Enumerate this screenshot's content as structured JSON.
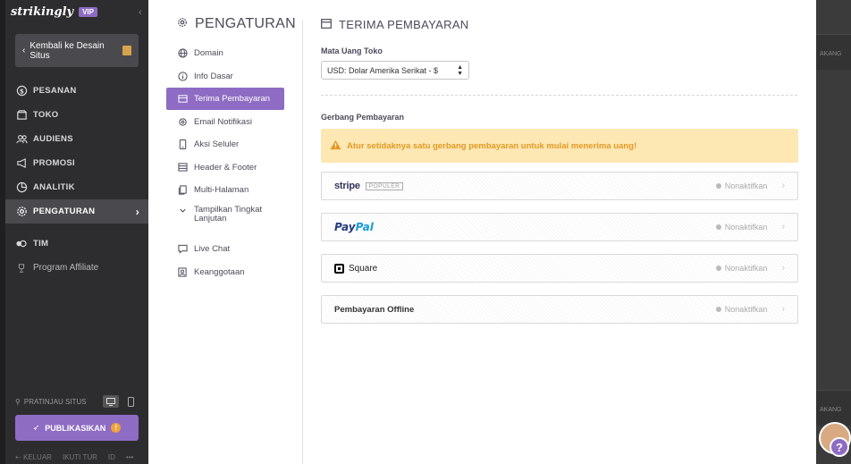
{
  "sidebar": {
    "brand": "strikingly",
    "badge": "VIP",
    "back_button": "Kembali ke Desain Situs",
    "items": [
      {
        "label": "PESANAN",
        "icon": "dollar-circle-icon"
      },
      {
        "label": "TOKO",
        "icon": "store-icon"
      },
      {
        "label": "AUDIENS",
        "icon": "users-icon"
      },
      {
        "label": "PROMOSI",
        "icon": "megaphone-icon"
      },
      {
        "label": "ANALITIK",
        "icon": "pie-chart-icon"
      },
      {
        "label": "PENGATURAN",
        "icon": "gear-icon"
      },
      {
        "label": "TIM",
        "icon": "team-icon"
      },
      {
        "label": "Program Affiliate",
        "icon": "trophy-icon"
      }
    ],
    "preview_label": "PRATINJAU SITUS",
    "publish_label": "PUBLIKASIKAN",
    "footer": [
      "KELUAR",
      "IKUTI TUR",
      "ID",
      "•••"
    ]
  },
  "settings_nav": {
    "title": "PENGATURAN",
    "items": [
      {
        "label": "Domain",
        "icon": "globe-icon"
      },
      {
        "label": "Info Dasar",
        "icon": "info-icon"
      },
      {
        "label": "Terima Pembayaran",
        "icon": "payment-icon"
      },
      {
        "label": "Email Notifikasi",
        "icon": "email-icon"
      },
      {
        "label": "Aksi Seluler",
        "icon": "mobile-icon"
      },
      {
        "label": "Header & Footer",
        "icon": "header-footer-icon"
      },
      {
        "label": "Multi-Halaman",
        "icon": "pages-icon"
      },
      {
        "label": "Tampilkan Tingkat Lanjutan",
        "icon": "chevron-down-icon"
      },
      {
        "label": "Live Chat",
        "icon": "chat-icon"
      },
      {
        "label": "Keanggotaan",
        "icon": "membership-icon"
      }
    ]
  },
  "payment": {
    "title": "TERIMA PEMBAYARAN",
    "currency_label": "Mata Uang Toko",
    "currency_value": "USD: Dolar Amerika Serikat - $",
    "gateway_label": "Gerbang Pembayaran",
    "alert": "Atur setidaknya satu gerbang pembayaran untuk mulai menerima uang!",
    "gateways": [
      {
        "name": "stripe",
        "badge": "POPULER",
        "status": "Nonaktifkan"
      },
      {
        "name_a": "Pay",
        "name_b": "Pal",
        "status": "Nonaktifkan"
      },
      {
        "name": "Square",
        "status": "Nonaktifkan"
      },
      {
        "name": "Pembayaran Offline",
        "status": "Nonaktifkan"
      }
    ]
  },
  "right_editor": {
    "strip_text": "AKANG"
  },
  "help_label": "?",
  "colors": {
    "accent": "#8e6cc3",
    "warning_bg": "#fde7b3",
    "warning_text": "#e39a24",
    "sidebar_bg": "#2d2d2f"
  }
}
